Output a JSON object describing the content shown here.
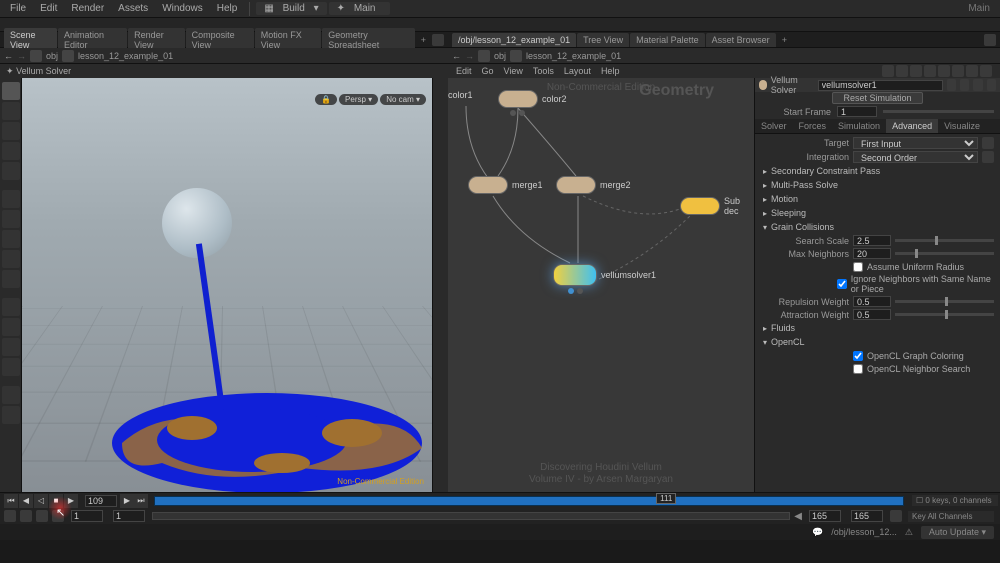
{
  "menubar": {
    "items": [
      "File",
      "Edit",
      "Render",
      "Assets",
      "Windows",
      "Help"
    ],
    "build": "Build",
    "main": "Main",
    "right_label": "Main"
  },
  "left": {
    "tabs": [
      "Scene View",
      "Animation Editor",
      "Render View",
      "Composite View",
      "Motion FX View",
      "Geometry Spreadsheet"
    ],
    "active_tab": 0,
    "path": {
      "obj": "obj",
      "node": "lesson_12_example_01"
    },
    "vp_header": {
      "title": "Vellum Solver"
    },
    "vp_ctrls": {
      "persp": "Persp",
      "cam": "No cam"
    },
    "watermark": "Non-Commercial Edition"
  },
  "right": {
    "tabs": [
      "/obj/lesson_12_example_01",
      "Tree View",
      "Material Palette",
      "Asset Browser"
    ],
    "active_tab": 0,
    "path": {
      "obj": "obj",
      "node": "lesson_12_example_01"
    },
    "net_menu": [
      "Edit",
      "Go",
      "View",
      "Tools",
      "Layout",
      "Help"
    ],
    "ng": {
      "title": "Non-Commercial Edition",
      "context": "Geometry",
      "wm1": "Discovering Houdini Vellum",
      "wm2": "Volume IV - by Arsen Margaryan"
    },
    "nodes": {
      "color1": "color1",
      "color2": "color2",
      "merge1": "merge1",
      "merge2": "merge2",
      "vellum": "vellumsolver1",
      "decon": "Sub\ndec"
    }
  },
  "params": {
    "header_title": "Vellum Solver",
    "node_name": "vellumsolver1",
    "reset": "Reset Simulation",
    "start_frame_label": "Start Frame",
    "start_frame": "1",
    "tabs": [
      "Solver",
      "Forces",
      "Simulation",
      "Advanced",
      "Visualize"
    ],
    "active_tab": 3,
    "target_label": "Target",
    "target_value": "First Input",
    "integration_label": "Integration",
    "integration_value": "Second Order",
    "sections": {
      "secondary": "Secondary Constraint Pass",
      "multipass": "Multi-Pass Solve",
      "motion": "Motion",
      "sleeping": "Sleeping",
      "grain": "Grain Collisions",
      "fluids": "Fluids",
      "opencl": "OpenCL"
    },
    "grain": {
      "search_scale_label": "Search Scale",
      "search_scale": "2.5",
      "max_neighbors_label": "Max Neighbors",
      "max_neighbors": "20",
      "assume_uniform": "Assume Uniform Radius",
      "ignore_neighbors": "Ignore Neighbors with Same Name or Piece",
      "repulsion_label": "Repulsion Weight",
      "repulsion": "0.5",
      "attraction_label": "Attraction Weight",
      "attraction": "0.5"
    },
    "opencl": {
      "graph_coloring": "OpenCL Graph Coloring",
      "neighbor_search": "OpenCL Neighbor Search"
    }
  },
  "timeline": {
    "current_frame": "109",
    "marker_frame": "111",
    "start": "1",
    "sstart": "1",
    "end": "165",
    "eend": "165",
    "channels": "0 keys, 0 channels",
    "key_all": "Key All Channels"
  },
  "status": {
    "path": "/obj/lesson_12...",
    "update": "Auto Update"
  }
}
